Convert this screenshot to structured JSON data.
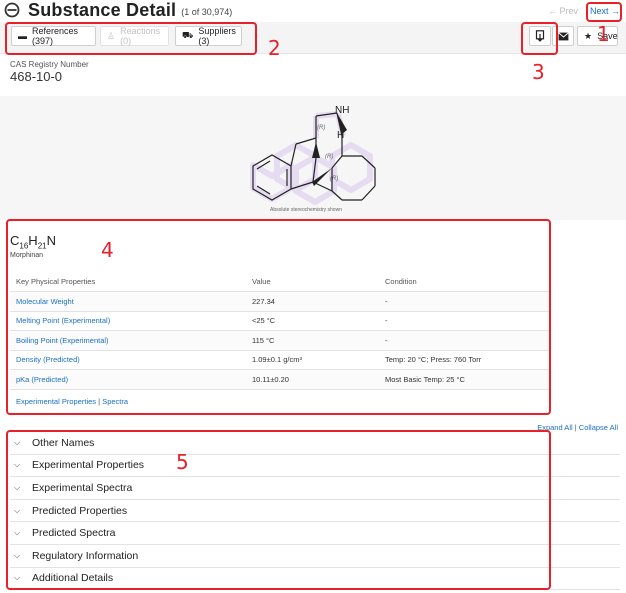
{
  "header": {
    "title": "Substance Detail",
    "count": "(1 of 30,974)",
    "prev_label": "← Prev",
    "next_label": "Next →"
  },
  "toolbar": {
    "references_label": "References (397)",
    "reactions_label": "Reactions (0)",
    "suppliers_label": "Suppliers (3)",
    "save_label": "Save"
  },
  "substance": {
    "cas_label": "CAS Registry Number",
    "cas_number": "468-10-0",
    "structure_labels": {
      "nh": "NH",
      "h": "H",
      "stereo_r": "(R)"
    },
    "stereo_note": "Absolute stereochemistry shown",
    "formula_parts": [
      "C",
      "16",
      "H",
      "21",
      "N"
    ],
    "name": "Morphinan"
  },
  "properties": {
    "headers": [
      "Key Physical Properties",
      "Value",
      "Condition"
    ],
    "rows": [
      {
        "name": "Molecular Weight",
        "value": "227.34",
        "condition": "-"
      },
      {
        "name": "Melting Point (Experimental)",
        "value": "<25 °C",
        "condition": "-"
      },
      {
        "name": "Boiling Point (Experimental)",
        "value": "115 °C",
        "condition": "-"
      },
      {
        "name": "Density (Predicted)",
        "value": "1.09±0.1 g/cm³",
        "condition": "Temp: 20 °C; Press: 760 Torr"
      },
      {
        "name": "pKa (Predicted)",
        "value": "10.11±0.20",
        "condition": "Most Basic Temp: 25 °C"
      }
    ],
    "exp_properties_link": "Experimental Properties",
    "spectra_link": "Spectra",
    "separator": "|"
  },
  "expand": {
    "expand_all": "Expand All",
    "collapse_all": "Collapse All",
    "separator": "|"
  },
  "sections": [
    "Other Names",
    "Experimental Properties",
    "Experimental Spectra",
    "Predicted Properties",
    "Predicted Spectra",
    "Regulatory Information",
    "Additional Details"
  ],
  "annotations": [
    "1",
    "2",
    "3",
    "4",
    "5"
  ],
  "colors": {
    "annotation": "#e8202a",
    "link": "#1a6fc4",
    "structure_highlight": "#e6dcf2"
  }
}
